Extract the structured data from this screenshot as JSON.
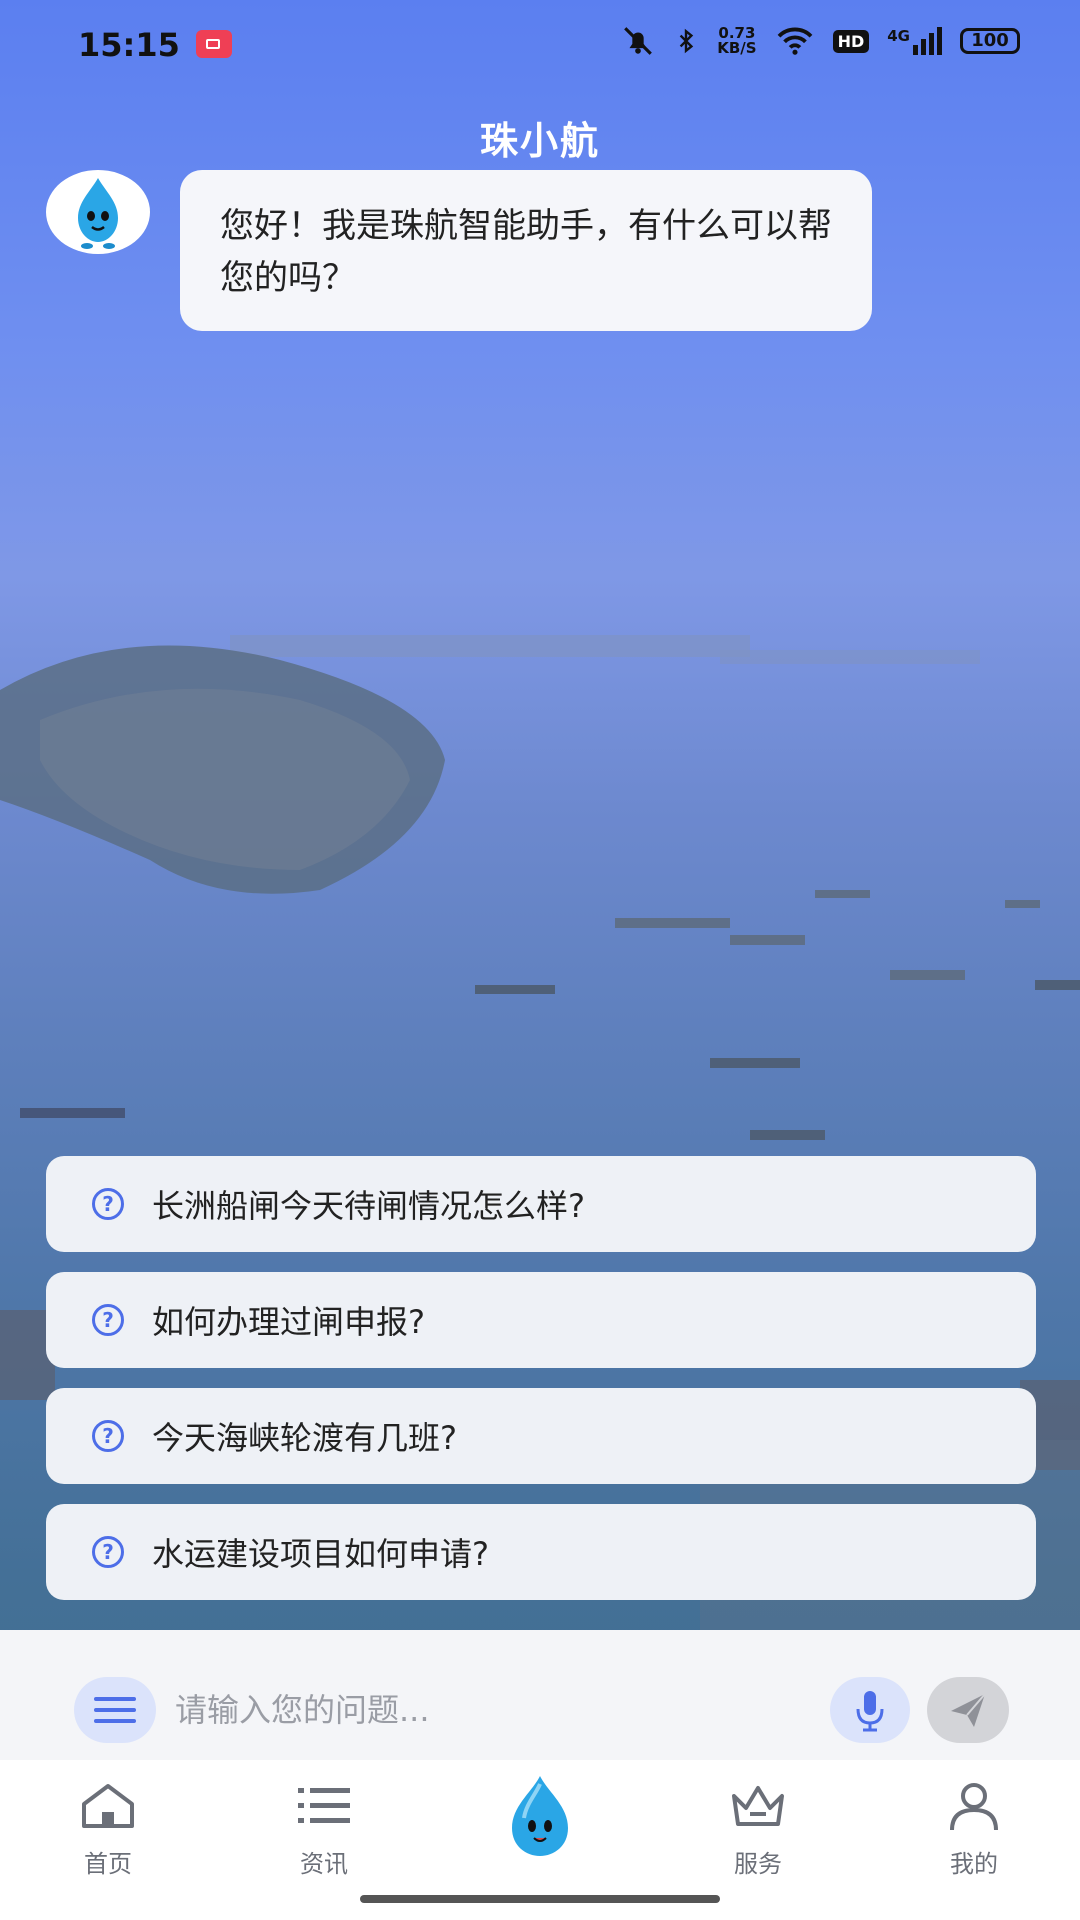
{
  "status_bar": {
    "time": "15:15",
    "net_speed_value": "0.73",
    "net_speed_unit": "KB/S",
    "hd_label": "HD",
    "network_label": "4G",
    "battery": "100"
  },
  "header": {
    "title": "珠小航"
  },
  "chat": {
    "greeting": "您好！我是珠航智能助手，有什么可以帮您的吗？"
  },
  "suggestions": [
    {
      "icon": "?",
      "text": "长洲船闸今天待闸情况怎么样?"
    },
    {
      "icon": "?",
      "text": "如何办理过闸申报?"
    },
    {
      "icon": "?",
      "text": "今天海峡轮渡有几班?"
    },
    {
      "icon": "?",
      "text": "水运建设项目如何申请?"
    }
  ],
  "input": {
    "placeholder": "请输入您的问题..."
  },
  "tabs": [
    {
      "label": "首页",
      "icon": "home-icon"
    },
    {
      "label": "资讯",
      "icon": "list-icon"
    },
    {
      "label": "",
      "icon": "mascot-icon"
    },
    {
      "label": "服务",
      "icon": "crown-icon"
    },
    {
      "label": "我的",
      "icon": "user-icon"
    }
  ],
  "colors": {
    "accent": "#4d6ee8",
    "sky_top": "#5b7ff0",
    "water": "#3e6c8a"
  }
}
